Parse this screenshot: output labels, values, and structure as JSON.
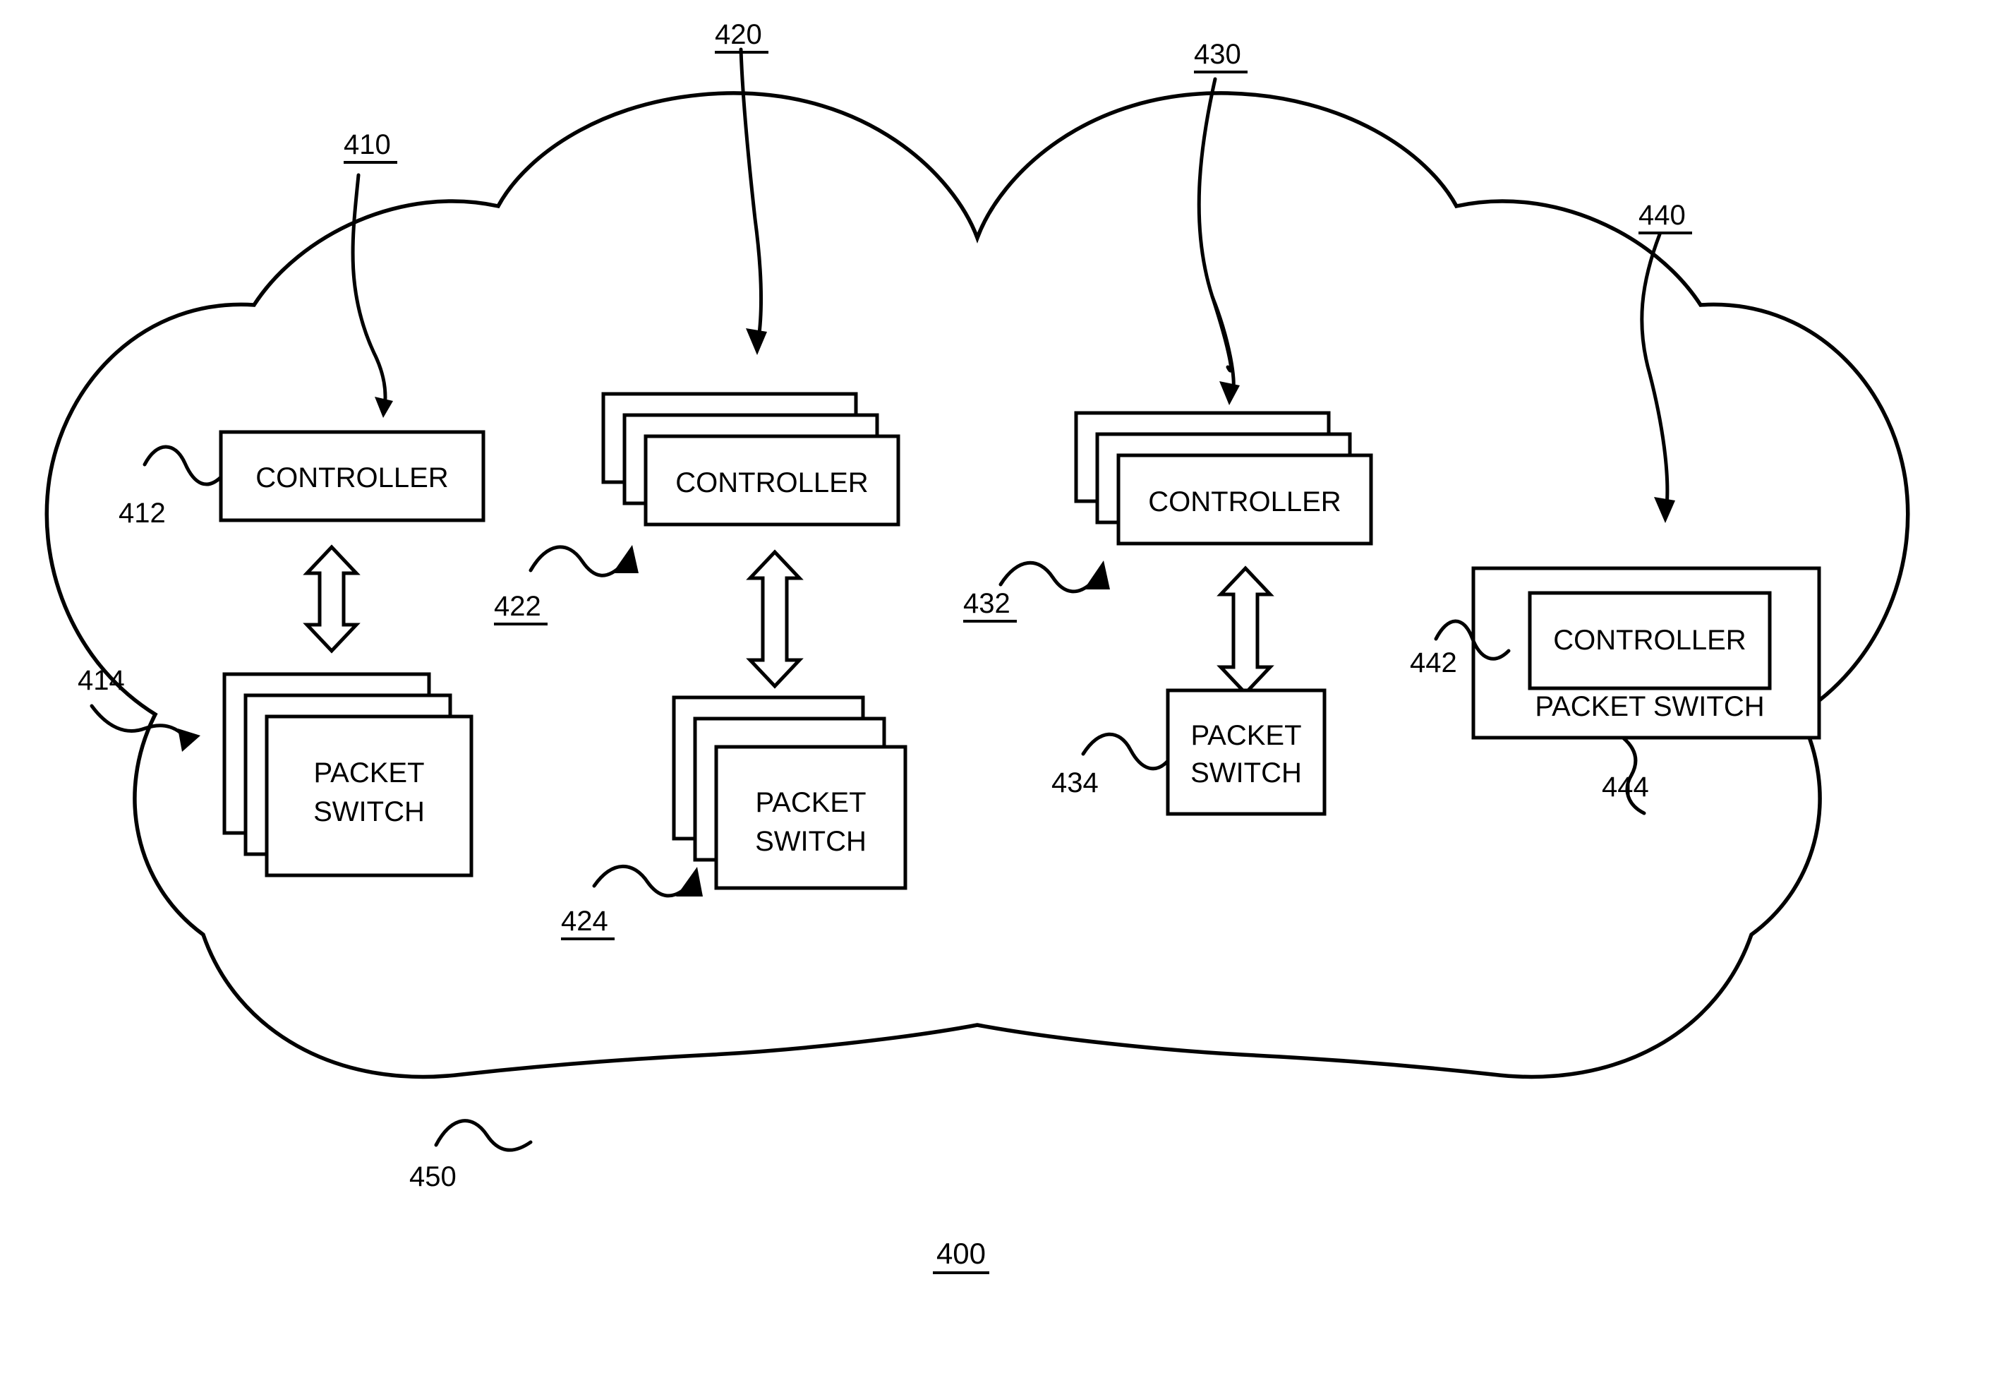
{
  "figure": {
    "number": "400",
    "domain_shape": "cloud-network-boundary",
    "cloud_ref": "450"
  },
  "nodes": [
    {
      "id": "group-410",
      "group_ref": "410",
      "controller": {
        "ref": "412",
        "label": "CONTROLLER",
        "stacked": false,
        "ref_underlined": false
      },
      "switch": {
        "ref": "414",
        "label_line1": "PACKET",
        "label_line2": "SWITCH",
        "stacked": true,
        "stack_count": 3,
        "ref_underlined": false
      },
      "link": "bidirectional"
    },
    {
      "id": "group-420",
      "group_ref": "420",
      "controller": {
        "ref": "422",
        "label": "CONTROLLER",
        "stacked": true,
        "stack_count": 3,
        "ref_underlined": true
      },
      "switch": {
        "ref": "424",
        "label_line1": "PACKET",
        "label_line2": "SWITCH",
        "stacked": true,
        "stack_count": 3,
        "ref_underlined": true
      },
      "link": "bidirectional"
    },
    {
      "id": "group-430",
      "group_ref": "430",
      "controller": {
        "ref": "432",
        "label": "CONTROLLER",
        "stacked": true,
        "stack_count": 3,
        "ref_underlined": true
      },
      "switch": {
        "ref": "434",
        "label_line1": "PACKET",
        "label_line2": "SWITCH",
        "stacked": false,
        "ref_underlined": false
      },
      "link": "bidirectional"
    },
    {
      "id": "group-440",
      "group_ref": "440",
      "combined": true,
      "outer": {
        "ref": "444",
        "label": "PACKET SWITCH"
      },
      "inner": {
        "ref": "442",
        "label": "CONTROLLER"
      }
    }
  ],
  "ref_labels": {
    "r410": "410",
    "r412": "412",
    "r414": "414",
    "r420": "420",
    "r422": "422",
    "r424": "424",
    "r430": "430",
    "r432": "432",
    "r434": "434",
    "r440": "440",
    "r442": "442",
    "r444": "444",
    "r450": "450",
    "r400": "400"
  },
  "box_text": {
    "controller": "CONTROLLER",
    "packet": "PACKET",
    "switch": "SWITCH",
    "packet_switch_inline": "PACKET SWITCH"
  },
  "colors": {
    "line": "#000000",
    "fill": "#ffffff"
  }
}
